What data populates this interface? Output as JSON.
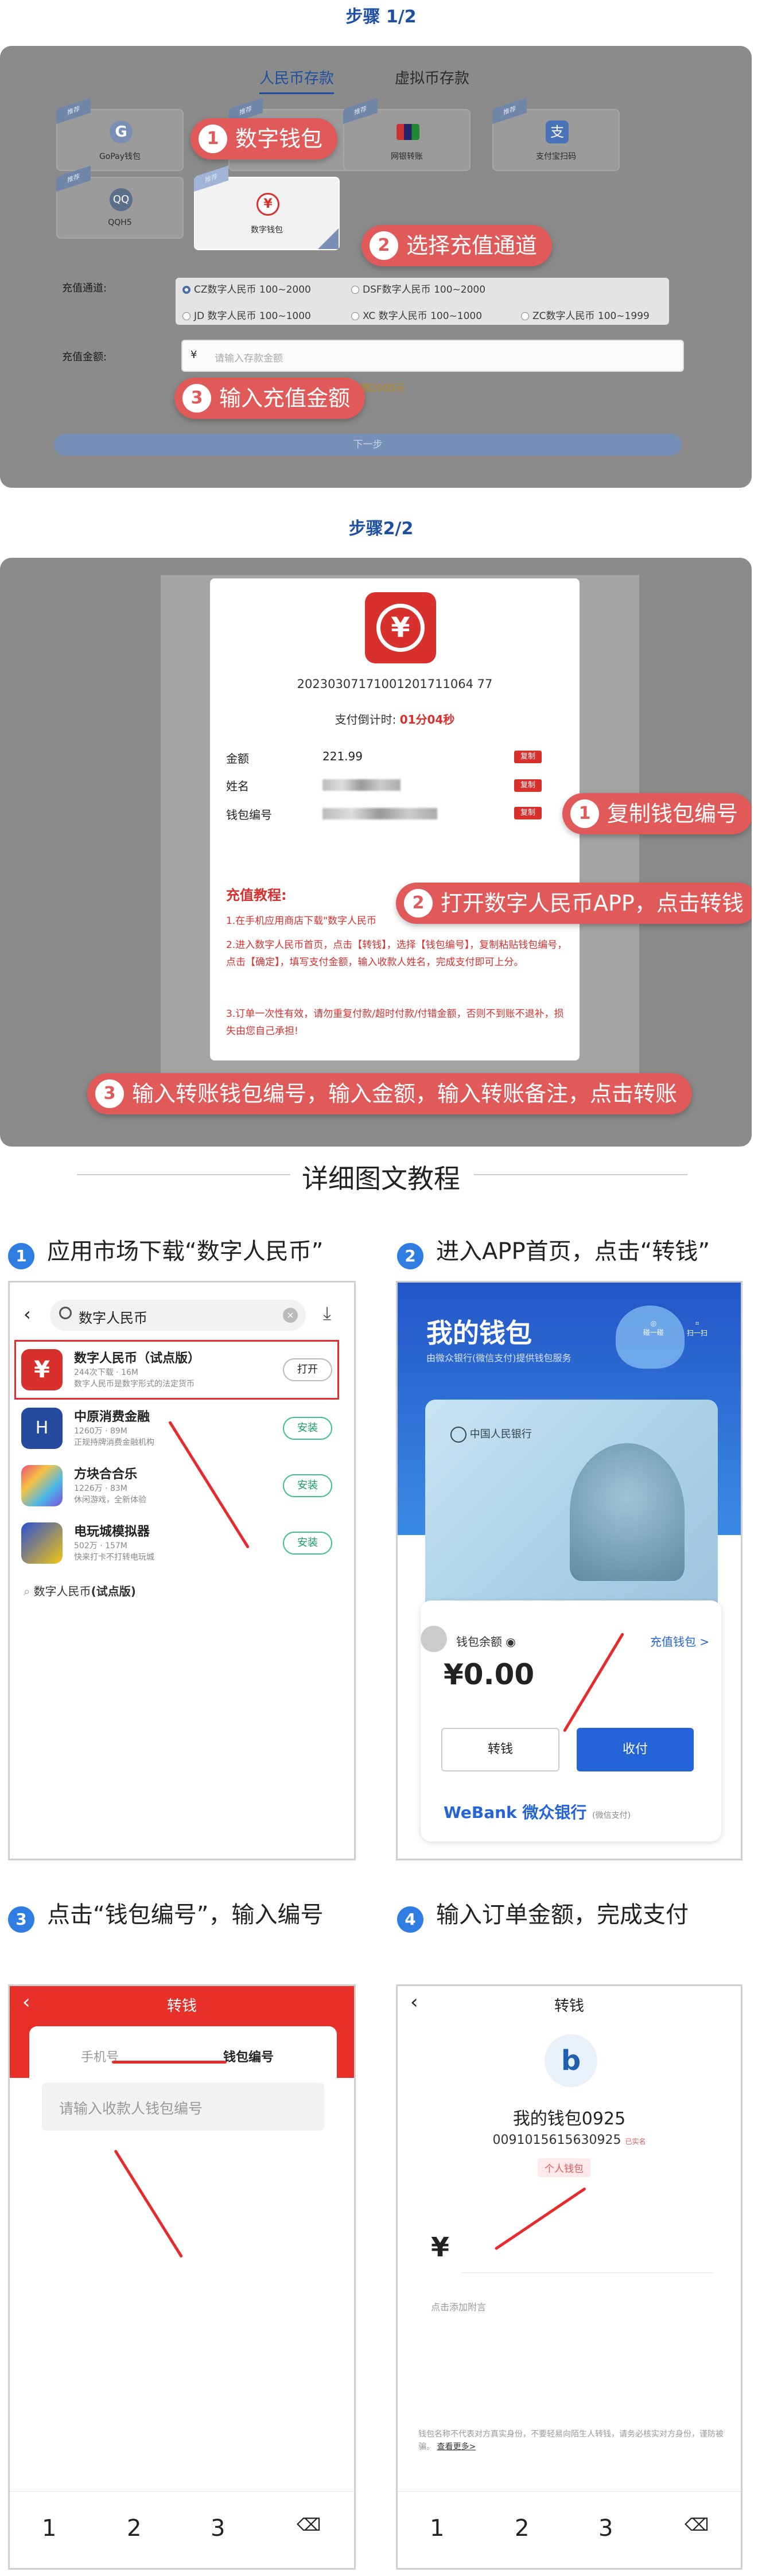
{
  "colors": {
    "accent": "#e05a5a",
    "brand_blue": "#1f4fa0",
    "step_blue": "#2f7de1",
    "ecny_red": "#d8302d",
    "webank_blue": "#2463d8"
  },
  "step1": {
    "title": "步骤 1/2",
    "tabs": [
      "人民币存款",
      "虚拟币存款"
    ],
    "tiles": [
      {
        "label": "GoPay钱包",
        "icon": "gopay-icon"
      },
      {
        "label": "",
        "icon": "card-icon"
      },
      {
        "label": "网银转账",
        "icon": "bank-card-icon"
      },
      {
        "label": "支付宝扫码",
        "icon": "alipay-icon"
      },
      {
        "label": "QQH5",
        "icon": "qq-icon"
      },
      {
        "label": "数字钱包",
        "icon": "ecny-icon"
      }
    ],
    "channel_label": "充值通道:",
    "channels_row1": [
      "CZ数字人民币 100~2000",
      "DSF数字人民币 100~2000"
    ],
    "channels_row2": [
      "JD 数字人民币 100~1000",
      "XC 数字人民币 100~1000",
      "ZC数字人民币 100~1999"
    ],
    "amount_label": "充值金额:",
    "amount_prefix": "¥",
    "amount_placeholder": "请输入存款金额",
    "amount_hint": "金额2000元",
    "next_button": "下一步",
    "callouts": [
      {
        "num": "1",
        "text": "数字钱包"
      },
      {
        "num": "2",
        "text": "选择充值通道"
      },
      {
        "num": "3",
        "text": "输入充值金额"
      }
    ]
  },
  "step2": {
    "title": "步骤2/2",
    "order_no": "20230307171001201711064 77",
    "countdown_label": "支付倒计时:",
    "countdown_value": "01分04秒",
    "rows": [
      {
        "label": "金额",
        "value": "221.99",
        "copy": "复制"
      },
      {
        "label": "姓名",
        "value": "",
        "copy": "复制"
      },
      {
        "label": "钱包编号",
        "value": "",
        "copy": "复制"
      }
    ],
    "tutorial_title": "充值教程:",
    "tutorial_lines": [
      "1.在手机应用商店下载\"数字人民币",
      "2.进入数字人民币首页，点击【转钱】，选择【钱包编号】，复制粘贴钱包编号，点击【确定】，填写支付金额，输入收款人姓名，完成支付即可上分。",
      "3.订单一次性有效，请勿重复付款/超时付款/付错金额，否则不到账不退补，损失由您自己承担!"
    ],
    "callouts": [
      {
        "num": "1",
        "text": "复制钱包编号"
      },
      {
        "num": "2",
        "text": "打开数字人民币APP，点击转钱"
      },
      {
        "num": "3",
        "text": "输入转账钱包编号，输入金额，输入转账备注，点击转账"
      }
    ]
  },
  "detail_title": "详细图文教程",
  "sections": [
    {
      "num": "1",
      "text": "应用市场下载“数字人民币”"
    },
    {
      "num": "2",
      "text": "进入APP首页，点击“转钱”"
    },
    {
      "num": "3",
      "text": "点击“钱包编号”，输入编号"
    },
    {
      "num": "4",
      "text": "输入订单金额，完成支付"
    }
  ],
  "store": {
    "search_text": "数字人民币",
    "apps": [
      {
        "name": "数字人民币（试点版）",
        "meta": "244次下载 · 16M",
        "desc": "数字人民币是数字形式的法定货币",
        "button": "打开"
      },
      {
        "name": "中原消费金融",
        "meta": "1260万 · 89M",
        "desc": "正规持牌消费金融机构",
        "button": "安装"
      },
      {
        "name": "方块合合乐",
        "meta": "1226万 · 83M",
        "desc": "休闲游戏，全新体验",
        "button": "安装"
      },
      {
        "name": "电玩城模拟器",
        "meta": "502万 · 157M",
        "desc": "快来打卡不打转电玩城",
        "button": "安装"
      }
    ],
    "suggest_prefix": "数字人民币",
    "suggest_bold": "(试点版)"
  },
  "wallet": {
    "title": "我的钱包",
    "subtitle": "由微众银行(微信支付)提供钱包服务",
    "bank_logo": "中国人民银行",
    "scan1": "碰一碰",
    "scan2": "扫一扫",
    "balance_label": "钱包余额",
    "topup": "充值钱包 >",
    "balance": "¥0.00",
    "transfer_btn": "转钱",
    "receive_btn": "收付",
    "webank": "WeBank 微众银行",
    "webank_sub": "(微信支付)"
  },
  "transfer": {
    "title": "转钱",
    "tab_phone": "手机号",
    "tab_wallet": "钱包编号",
    "placeholder": "请输入收款人钱包编号",
    "keys": [
      "1",
      "2",
      "3"
    ]
  },
  "pay": {
    "title": "转钱",
    "wallet_name": "我的钱包0925",
    "wallet_no": "0091015615630925",
    "wallet_tag": "已实名",
    "personal_tag": "个人钱包",
    "currency": "¥",
    "remark": "点击添加附言",
    "notice": "钱包名称不代表对方真实身份，不要轻易向陌生人转钱，请务必核实对方身份，谨防被骗。",
    "notice_more": "查看更多>",
    "keys": [
      "1",
      "2",
      "3"
    ]
  }
}
